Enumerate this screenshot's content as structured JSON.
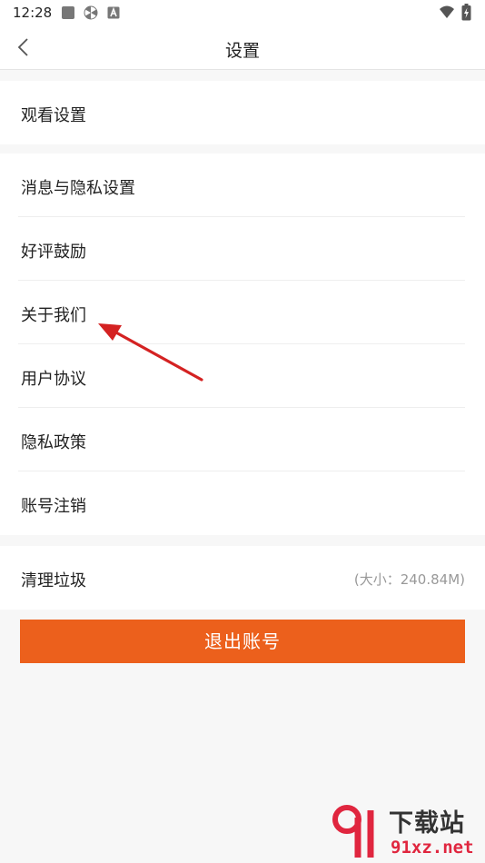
{
  "status_bar": {
    "time": "12:28"
  },
  "header": {
    "title": "设置"
  },
  "sections": [
    {
      "items": [
        {
          "label": "观看设置"
        }
      ]
    },
    {
      "items": [
        {
          "label": "消息与隐私设置"
        },
        {
          "label": "好评鼓励"
        },
        {
          "label": "关于我们"
        },
        {
          "label": "用户协议"
        },
        {
          "label": "隐私政策"
        },
        {
          "label": "账号注销"
        }
      ]
    },
    {
      "items": [
        {
          "label": "清理垃圾",
          "detail": "(大小：240.84M)"
        }
      ]
    }
  ],
  "logout_label": "退出账号",
  "watermark": {
    "text_top": "下载站",
    "text_bottom": "91xz.net"
  },
  "colors": {
    "accent": "#ec601c",
    "background": "#f7f7f7",
    "annotation_arrow": "#d42222"
  },
  "icons": [
    "back-arrow-icon",
    "gallery-icon",
    "pinwheel-icon",
    "app-a-icon",
    "wifi-icon",
    "battery-icon"
  ]
}
